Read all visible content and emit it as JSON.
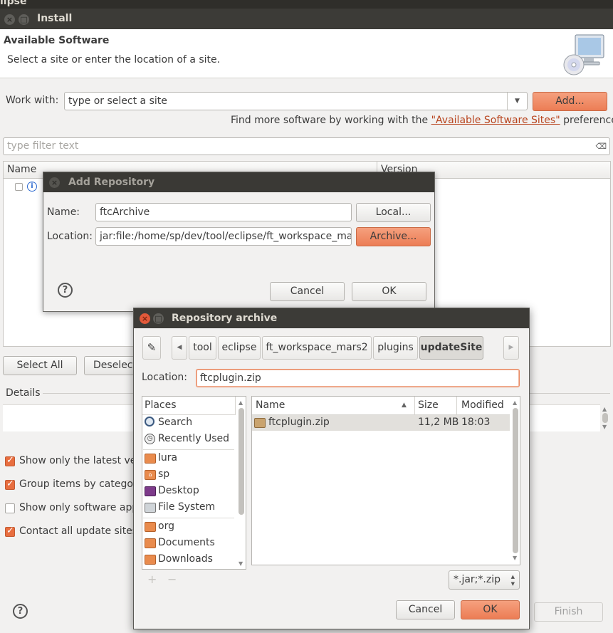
{
  "main_window": {
    "top_title": "lipse",
    "title": "Install",
    "header_title": "Available Software",
    "header_subtitle": "Select a site or enter the location of a site.",
    "work_with_label": "Work with:",
    "work_with_value": "type or select a site",
    "add_button": "Add...",
    "find_more_prefix": "Find more software by working with the ",
    "find_more_link": "\"Available Software Sites\"",
    "find_more_suffix": " preferences.",
    "filter_placeholder": "type filter text",
    "columns": {
      "name": "Name",
      "version": "Version"
    },
    "select_all_button": "Select All",
    "deselect_button": "Deselect",
    "details_label": "Details",
    "options": [
      {
        "label": "Show only the latest vers",
        "checked": true
      },
      {
        "label": "Group items by category",
        "checked": true
      },
      {
        "label": "Show only software app",
        "checked": false
      },
      {
        "label": "Contact all update sites",
        "checked": true
      }
    ],
    "finish_button": "Finish"
  },
  "add_repository": {
    "title": "Add Repository",
    "name_label": "Name:",
    "name_value": "ftcArchive",
    "local_button": "Local...",
    "location_label": "Location:",
    "location_value": "jar:file:/home/sp/dev/tool/eclipse/ft_workspace_ma",
    "archive_button": "Archive...",
    "cancel_button": "Cancel",
    "ok_button": "OK"
  },
  "repository_archive": {
    "title": "Repository archive",
    "breadcrumbs": [
      "tool",
      "eclipse",
      "ft_workspace_mars2",
      "plugins",
      "updateSite"
    ],
    "location_label": "Location:",
    "location_value": "ftcplugin.zip",
    "places_header": "Places",
    "places": [
      {
        "label": "Search",
        "icon": "search-icon"
      },
      {
        "label": "Recently Used",
        "icon": "recent-icon"
      },
      {
        "label": "lura",
        "icon": "folder-icon"
      },
      {
        "label": "sp",
        "icon": "home-folder-icon"
      },
      {
        "label": "Desktop",
        "icon": "desktop-icon"
      },
      {
        "label": "File System",
        "icon": "drive-icon"
      },
      {
        "label": "org",
        "icon": "folder-icon"
      },
      {
        "label": "Documents",
        "icon": "documents-icon"
      },
      {
        "label": "Downloads",
        "icon": "downloads-icon"
      }
    ],
    "add_place": "+",
    "remove_place": "−",
    "file_columns": {
      "name": "Name",
      "size": "Size",
      "modified": "Modified"
    },
    "files": [
      {
        "name": "ftcplugin.zip",
        "size": "11,2 MB",
        "modified": "18:03"
      }
    ],
    "filter_value": "*.jar;*.zip",
    "cancel_button": "Cancel",
    "ok_button": "OK"
  },
  "colors": {
    "accent": "#ec7d55",
    "titlebar": "#3c3b37",
    "link": "#b8441e",
    "selection": "#e2e0dc"
  }
}
